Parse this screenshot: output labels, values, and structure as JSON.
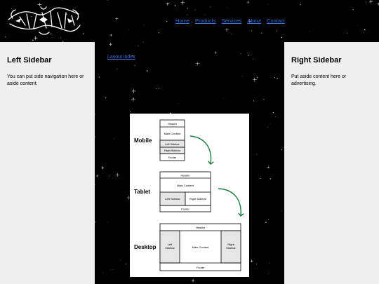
{
  "nav": {
    "links": [
      "Home",
      "Products",
      "Services",
      "About",
      "Contact"
    ]
  },
  "left_sidebar": {
    "title": "Left Sidebar",
    "text": "You can put side navigation here or aside content."
  },
  "right_sidebar": {
    "title": "Right Sidebar",
    "text": "Put aside content here or advertising."
  },
  "main": {
    "layout_link": "Layout index"
  },
  "diagram": {
    "mobile": {
      "label": "Mobile",
      "header": "Header",
      "main": "Main Content",
      "left": "Left Sidebar",
      "right": "Right Sidebar",
      "footer": "Footer"
    },
    "tablet": {
      "label": "Tablet",
      "header": "Header",
      "main": "Main Content",
      "left": "Left Sidebar",
      "right": "Right Sidebar",
      "footer": "Footer"
    },
    "desktop": {
      "label": "Desktop",
      "header": "Header",
      "left_l1": "Left",
      "left_l2": "Sidebar",
      "main": "Main Content",
      "right_l1": "Right",
      "right_l2": "Sidebar",
      "footer": "Footer"
    },
    "arrow_color": "#1f7a3f"
  },
  "colors": {
    "background": "#000000",
    "sidebar_bg": "#efefef",
    "link": "#3f6fd6",
    "sidebar_shade": "#e6e6e6"
  }
}
